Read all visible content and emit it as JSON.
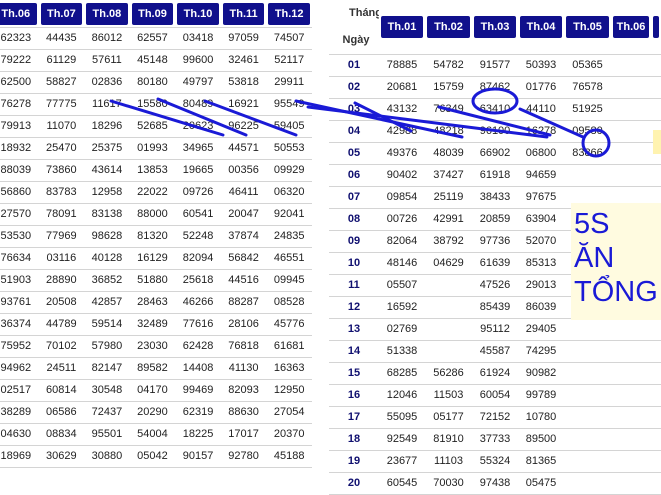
{
  "left_table": {
    "months": [
      "Th.06",
      "Th.07",
      "Th.08",
      "Th.09",
      "Th.10",
      "Th.11",
      "Th.12"
    ],
    "rows": [
      [
        "62323",
        "44435",
        "86012",
        "62557",
        "03418",
        "97059",
        "74507"
      ],
      [
        "79222",
        "61129",
        "57611",
        "45148",
        "99600",
        "32461",
        "52117"
      ],
      [
        "62500",
        "58827",
        "02836",
        "80180",
        "49797",
        "53818",
        "29911"
      ],
      [
        "76278",
        "77775",
        "11617",
        "15580",
        "80489",
        "16921",
        "95549"
      ],
      [
        "79913",
        "11070",
        "18296",
        "52685",
        "20623",
        "96225",
        "59405"
      ],
      [
        "18932",
        "25470",
        "25375",
        "01993",
        "34965",
        "44571",
        "50553"
      ],
      [
        "88039",
        "73860",
        "43614",
        "13853",
        "19665",
        "00356",
        "09929"
      ],
      [
        "56860",
        "83783",
        "12958",
        "22022",
        "09726",
        "46411",
        "06320"
      ],
      [
        "27570",
        "78091",
        "83138",
        "88000",
        "60541",
        "20047",
        "92041"
      ],
      [
        "53530",
        "77969",
        "98628",
        "81320",
        "52248",
        "37874",
        "24835"
      ],
      [
        "76634",
        "03116",
        "40128",
        "16129",
        "82094",
        "56842",
        "46551"
      ],
      [
        "51903",
        "28890",
        "36852",
        "51880",
        "25618",
        "44516",
        "09945"
      ],
      [
        "93761",
        "20508",
        "42857",
        "28463",
        "46266",
        "88287",
        "08528"
      ],
      [
        "36374",
        "44789",
        "59514",
        "32489",
        "77616",
        "28106",
        "45776"
      ],
      [
        "75952",
        "70102",
        "57980",
        "23030",
        "62428",
        "76818",
        "61681"
      ],
      [
        "94962",
        "24511",
        "82147",
        "89582",
        "14408",
        "41130",
        "16363"
      ],
      [
        "02517",
        "60814",
        "30548",
        "04170",
        "99469",
        "82093",
        "12950"
      ],
      [
        "38289",
        "06586",
        "72437",
        "20290",
        "62319",
        "88630",
        "27054"
      ],
      [
        "04630",
        "08834",
        "95501",
        "54004",
        "18225",
        "17017",
        "20370"
      ],
      [
        "18969",
        "30629",
        "30880",
        "05042",
        "90157",
        "92780",
        "45188"
      ]
    ]
  },
  "right_table": {
    "corner_top": "Tháng",
    "corner_bottom": "Ngày",
    "months": [
      "Th.01",
      "Th.02",
      "Th.03",
      "Th.04",
      "Th.05",
      "Th.06",
      ""
    ],
    "days": [
      "01",
      "02",
      "03",
      "04",
      "05",
      "06",
      "07",
      "08",
      "09",
      "10",
      "11",
      "12",
      "13",
      "14",
      "15",
      "16",
      "17",
      "18",
      "19",
      "20"
    ],
    "rows": [
      [
        "78885",
        "54782",
        "91577",
        "50393",
        "05365"
      ],
      [
        "20681",
        "15759",
        "87462",
        "01776",
        "76578"
      ],
      [
        "43132",
        "76349",
        "63410",
        "44110",
        "51925"
      ],
      [
        "42988",
        "48218",
        "96100",
        "16278",
        "09580"
      ],
      [
        "49376",
        "48039",
        "66902",
        "06800",
        "83866"
      ],
      [
        "90402",
        "37427",
        "61918",
        "94659",
        ""
      ],
      [
        "09854",
        "25119",
        "38433",
        "97675",
        ""
      ],
      [
        "00726",
        "42991",
        "20859",
        "63904",
        ""
      ],
      [
        "82064",
        "38792",
        "97736",
        "52070",
        ""
      ],
      [
        "48146",
        "04629",
        "61639",
        "85313",
        ""
      ],
      [
        "05507",
        "",
        "47526",
        "29013",
        ""
      ],
      [
        "16592",
        "",
        "85439",
        "86039",
        ""
      ],
      [
        "02769",
        "",
        "95112",
        "29405",
        ""
      ],
      [
        "51338",
        "",
        "45587",
        "74295",
        ""
      ],
      [
        "68285",
        "56286",
        "61924",
        "90982",
        ""
      ],
      [
        "12046",
        "11503",
        "60054",
        "99789",
        ""
      ],
      [
        "55095",
        "05177",
        "72152",
        "10780",
        ""
      ],
      [
        "92549",
        "81910",
        "37733",
        "89500",
        ""
      ],
      [
        "23677",
        "11103",
        "55324",
        "81365",
        ""
      ],
      [
        "60545",
        "70030",
        "97438",
        "05475",
        ""
      ]
    ]
  },
  "promo": {
    "line1": "5S",
    "line2": "ĂN",
    "line3": "TỔNG"
  },
  "colors": {
    "header_bg": "#10108c",
    "annotation": "#1a1ad6",
    "promo_bg": "#fffbe0"
  }
}
